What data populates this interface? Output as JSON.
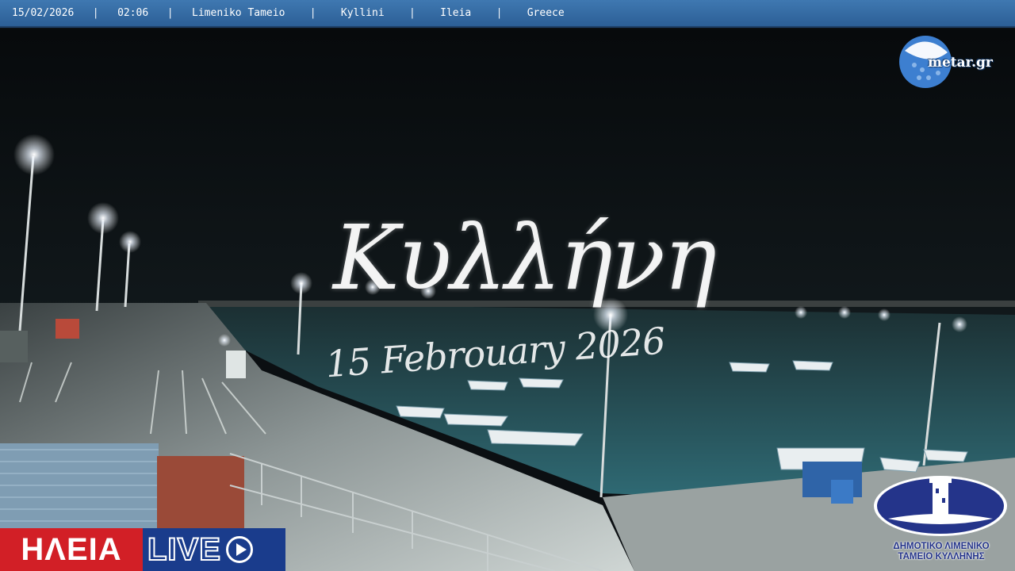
{
  "topbar": {
    "date": "15/02/2026",
    "time": "02:06",
    "location": "Limeniko Tameio",
    "town": "Kyllini",
    "region": "Ileia",
    "country": "Greece",
    "separator": "|"
  },
  "watermark": {
    "title": "Κυλλήνη",
    "date": "15 Febrouary 2026"
  },
  "logos": {
    "metar_label": "metar.gr",
    "ileia_label": "ΗΛΕΙΑ",
    "live_label": "LIVE",
    "port_line1": "ΔΗΜΟΤΙΚΟ ΛΙΜΕΝΙΚΟ",
    "port_line2": "ΤΑΜΕΙΟ ΚΥΛΛΗΝΗΣ"
  },
  "colors": {
    "topbar": "#3f78b1",
    "ileia_red": "#d21f26",
    "live_blue": "#1a3c8c",
    "sea": "#2f6a74",
    "sky": "#0b0f12"
  }
}
